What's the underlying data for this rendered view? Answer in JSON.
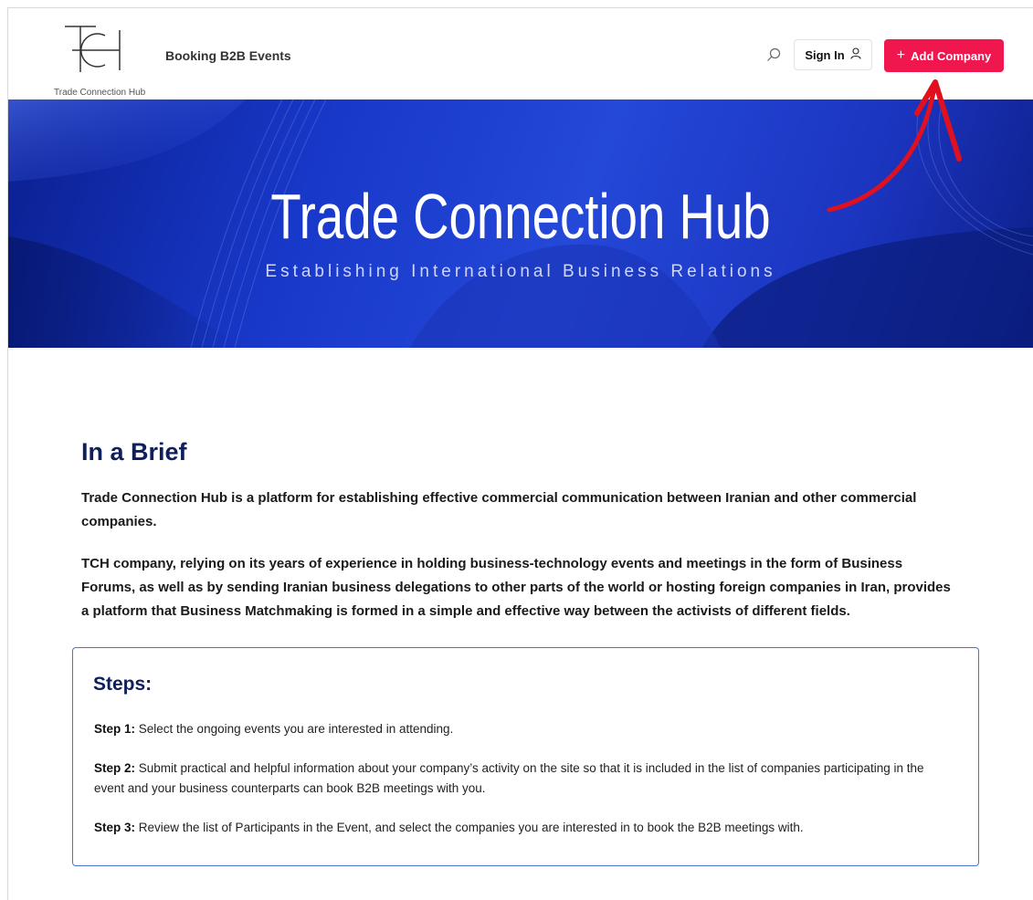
{
  "header": {
    "logo_text": "Trade Connection Hub",
    "nav_link": "Booking B2B Events",
    "search_icon": "search-icon",
    "signin_label": "Sign In",
    "signin_icon": "user-icon",
    "add_label": "Add Company",
    "add_icon": "plus-icon",
    "accent_color": "#f0174f"
  },
  "hero": {
    "title": "Trade Connection Hub",
    "subtitle": "Establishing International Business Relations"
  },
  "brief": {
    "title": "In a Brief",
    "paragraph1": "Trade Connection Hub is a platform for establishing effective commercial communication between Iranian and other commercial companies.",
    "paragraph2": "TCH company, relying on its years of experience in holding business-technology events and meetings in the form of Business Forums, as well as by sending Iranian business delegations to other parts of the world or hosting foreign companies in Iran, provides a platform that Business Matchmaking is formed in a simple and effective way between the activists of different fields."
  },
  "steps": {
    "title": "Steps:",
    "items": [
      {
        "label": "Step 1:",
        "text": " Select the ongoing events you are interested in attending."
      },
      {
        "label": "Step 2:",
        "text": " Submit practical and helpful information about your company’s activity on the site so that it is included in the list of companies participating in the event and your business counterparts can book B2B meetings with you."
      },
      {
        "label": "Step 3:",
        "text": " Review the list of Participants in the Event, and select the companies you are interested in to book the B2B meetings with."
      }
    ]
  }
}
